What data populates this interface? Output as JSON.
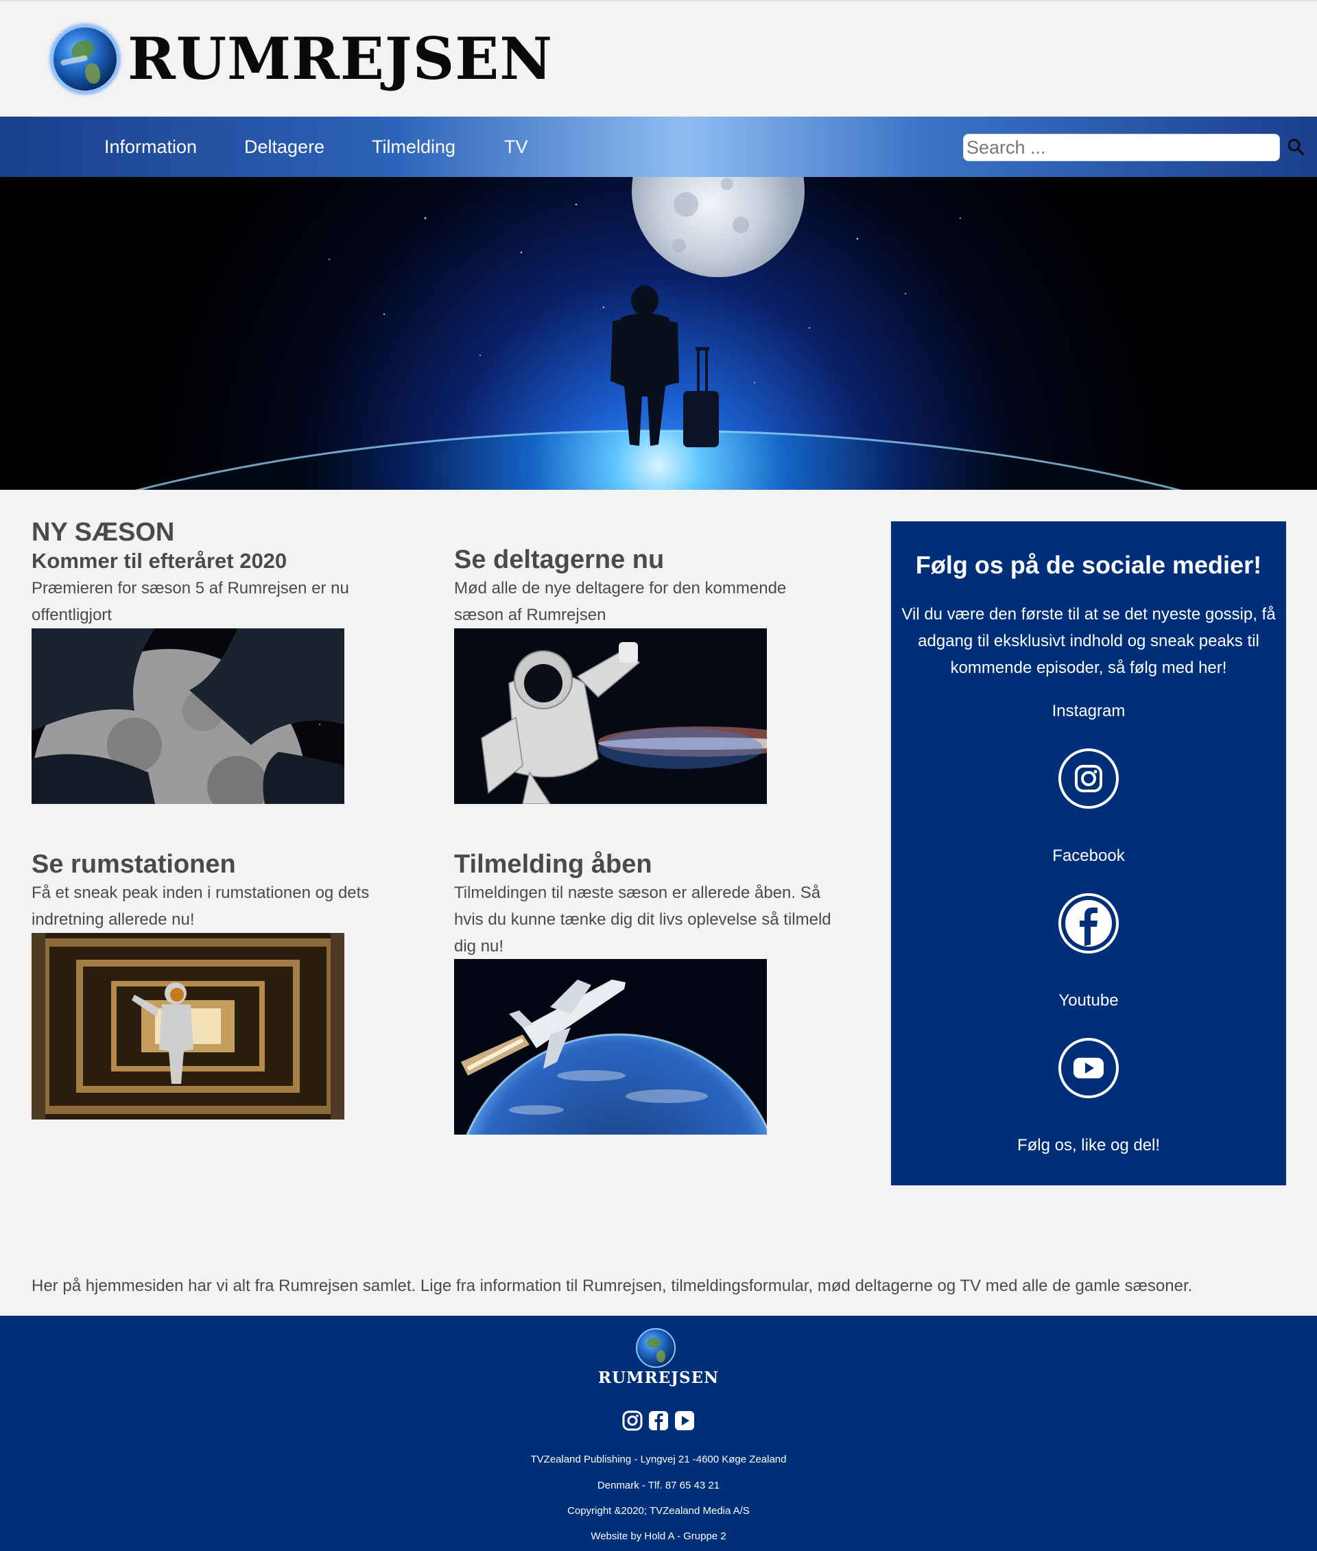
{
  "brand": {
    "name": "Rumrejsen",
    "logo_text": "RUMREJSEN"
  },
  "nav": {
    "items": [
      "Information",
      "Deltagere",
      "Tilmelding",
      "TV"
    ],
    "search_placeholder": "Search ..."
  },
  "cards": [
    {
      "title": "NY SÆSON",
      "subtitle": "Kommer til efteråret 2020",
      "text": "Præmieren for sæson 5 af Rumrejsen er nu offentligjort"
    },
    {
      "title": "Se deltagerne nu",
      "text": "Mød alle de nye deltagere for den kommende sæson af Rumrejsen"
    },
    {
      "title": "Se rumstationen",
      "text": "Få et sneak peak inden i rumstationen og dets indretning allerede nu!"
    },
    {
      "title": "Tilmelding åben",
      "text": "Tilmeldingen til næste sæson er allerede åben. Så hvis du kunne tænke dig dit livs oplevelse så tilmeld dig nu!"
    }
  ],
  "social": {
    "title": "Følg os på de sociale medier!",
    "text": "Vil du være den første til at se det nyeste gossip, få adgang til eksklusivt indhold og sneak peaks til kommende episoder, så følg med her!",
    "links": [
      {
        "label": "Instagram",
        "icon": "instagram-icon"
      },
      {
        "label": "Facebook",
        "icon": "facebook-icon"
      },
      {
        "label": "Youtube",
        "icon": "youtube-icon"
      }
    ],
    "follow_text": "Følg os, like og del!"
  },
  "intro_text": "Her på hjemmesiden har vi alt fra Rumrejsen samlet. Lige fra information til Rumrejsen, tilmeldingsformular, mød deltagerne og TV med alle de gamle sæsoner.",
  "footer": {
    "logo_text": "RUMREJSEN",
    "lines": [
      "TVZealand Publishing - Lyngvej 21 -4600 Køge Zealand",
      "Denmark - Tlf. 87 65 43 21",
      "Copyright &2020; TVZealand Media A/S",
      "Website by Hold A - Gruppe 2"
    ]
  },
  "colors": {
    "nav_dark": "#1a3f8c",
    "nav_light": "#8fbcf2",
    "panel": "#002f7a",
    "text": "#4a4a4a",
    "page_bg": "#f3f3f3"
  }
}
